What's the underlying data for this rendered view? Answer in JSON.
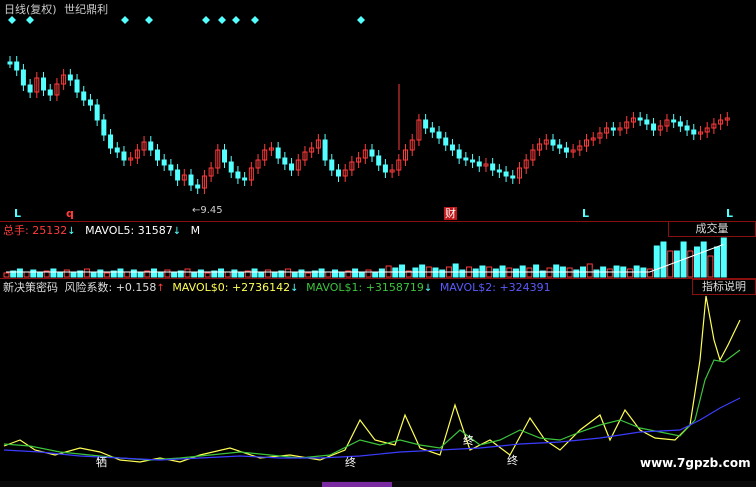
{
  "header": {
    "chart_title": "日线(复权)",
    "stock_name": "世纪鼎利"
  },
  "price_panel": {
    "low_annotation": "9.45",
    "marker_L": "L",
    "marker_q": "q",
    "marker_cai": "财",
    "colors": {
      "up": "#ff3c3c",
      "down": "#54ffff",
      "marker_diamond": "#54ffff"
    }
  },
  "volume_panel": {
    "total_label": "总手: ",
    "total_value": "25132",
    "mavol5_label": "MAVOL5: ",
    "mavol5_value": "31587",
    "truncated_label": "M",
    "button_label": "成交量"
  },
  "indicator_panel": {
    "name": "新决策密码",
    "risk_label": "风险系数: ",
    "risk_value": "+0.158",
    "mavol0_label": "MAVOL$0: ",
    "mavol0_value": "+2736142",
    "mavol1_label": "MAVOL$1: ",
    "mavol1_value": "+3158719",
    "mavol2_label": "MAVOL$2: ",
    "mavol2_value": "+324391",
    "button_label": "指标说明",
    "marker_xi": "牺",
    "marker_zhong": "终",
    "colors": {
      "line0": "#ffff54",
      "line1": "#3cc43c",
      "line2": "#3c3cff"
    }
  },
  "watermark": "www.7gpzb.com"
}
